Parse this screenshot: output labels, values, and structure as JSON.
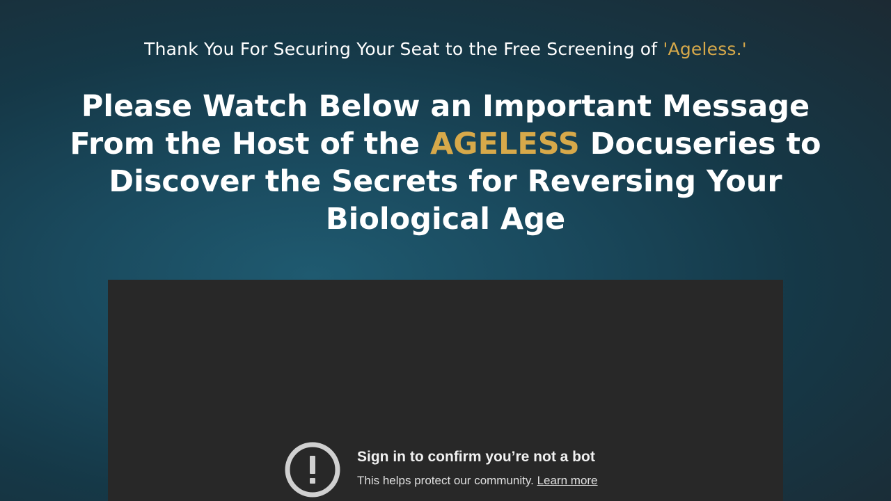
{
  "header": {
    "subtitle_prefix": "Thank You For Securing Your Seat to the Free Screening of ",
    "subtitle_highlight": "'Ageless.'",
    "headline_part1": "Please Watch Below an Important Message From the Host of the ",
    "headline_highlight": "AGELESS",
    "headline_part2": " Docuseries to Discover the Secrets for Reversing Your Biological Age"
  },
  "video": {
    "notice_title": "Sign in to confirm you’re not a bot",
    "notice_body": "This helps protect our community.",
    "learn_more_label": "Learn more",
    "icon": "alert-exclamation-icon"
  },
  "colors": {
    "accent_gold": "#d7a94a",
    "background": "#1a4a5e",
    "video_bg": "#282828"
  }
}
